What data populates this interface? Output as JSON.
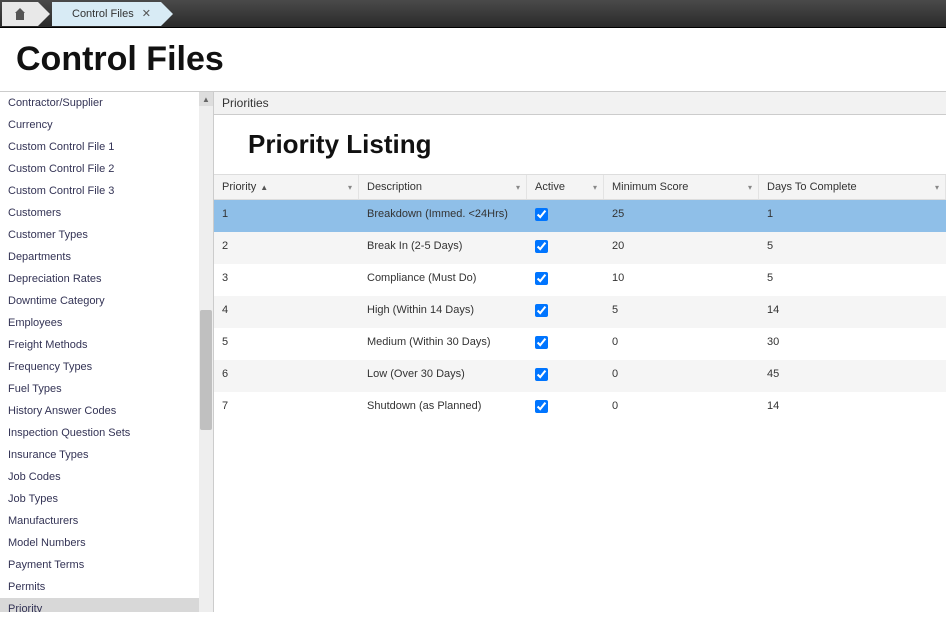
{
  "topbar": {
    "active_tab_label": "Control Files"
  },
  "page_title": "Control Files",
  "sidebar": {
    "items": [
      {
        "label": "Contractor/Supplier",
        "selected": false
      },
      {
        "label": "Currency",
        "selected": false
      },
      {
        "label": "Custom Control File 1",
        "selected": false
      },
      {
        "label": "Custom Control File 2",
        "selected": false
      },
      {
        "label": "Custom Control File 3",
        "selected": false
      },
      {
        "label": "Customers",
        "selected": false
      },
      {
        "label": "Customer Types",
        "selected": false
      },
      {
        "label": "Departments",
        "selected": false
      },
      {
        "label": "Depreciation Rates",
        "selected": false
      },
      {
        "label": "Downtime Category",
        "selected": false
      },
      {
        "label": "Employees",
        "selected": false
      },
      {
        "label": "Freight Methods",
        "selected": false
      },
      {
        "label": "Frequency Types",
        "selected": false
      },
      {
        "label": "Fuel Types",
        "selected": false
      },
      {
        "label": "History Answer Codes",
        "selected": false
      },
      {
        "label": "Inspection Question Sets",
        "selected": false
      },
      {
        "label": "Insurance Types",
        "selected": false
      },
      {
        "label": "Job Codes",
        "selected": false
      },
      {
        "label": "Job Types",
        "selected": false
      },
      {
        "label": "Manufacturers",
        "selected": false
      },
      {
        "label": "Model Numbers",
        "selected": false
      },
      {
        "label": "Payment Terms",
        "selected": false
      },
      {
        "label": "Permits",
        "selected": false
      },
      {
        "label": "Priority",
        "selected": true
      }
    ]
  },
  "panel_header": "Priorities",
  "listing_title": "Priority Listing",
  "grid": {
    "columns": [
      {
        "label": "Priority",
        "sorted_asc": true
      },
      {
        "label": "Description"
      },
      {
        "label": "Active"
      },
      {
        "label": "Minimum Score"
      },
      {
        "label": "Days To Complete"
      }
    ],
    "rows": [
      {
        "priority": "1",
        "description": "Breakdown (Immed. <24Hrs)",
        "active": true,
        "min_score": "25",
        "days": "1",
        "selected": true
      },
      {
        "priority": "2",
        "description": "Break In (2-5 Days)",
        "active": true,
        "min_score": "20",
        "days": "5",
        "selected": false
      },
      {
        "priority": "3",
        "description": "Compliance (Must Do)",
        "active": true,
        "min_score": "10",
        "days": "5",
        "selected": false
      },
      {
        "priority": "4",
        "description": "High (Within 14 Days)",
        "active": true,
        "min_score": "5",
        "days": "14",
        "selected": false
      },
      {
        "priority": "5",
        "description": "Medium (Within 30 Days)",
        "active": true,
        "min_score": "0",
        "days": "30",
        "selected": false
      },
      {
        "priority": "6",
        "description": "Low (Over 30 Days)",
        "active": true,
        "min_score": "0",
        "days": "45",
        "selected": false
      },
      {
        "priority": "7",
        "description": "Shutdown (as Planned)",
        "active": true,
        "min_score": "0",
        "days": "14",
        "selected": false
      }
    ]
  }
}
